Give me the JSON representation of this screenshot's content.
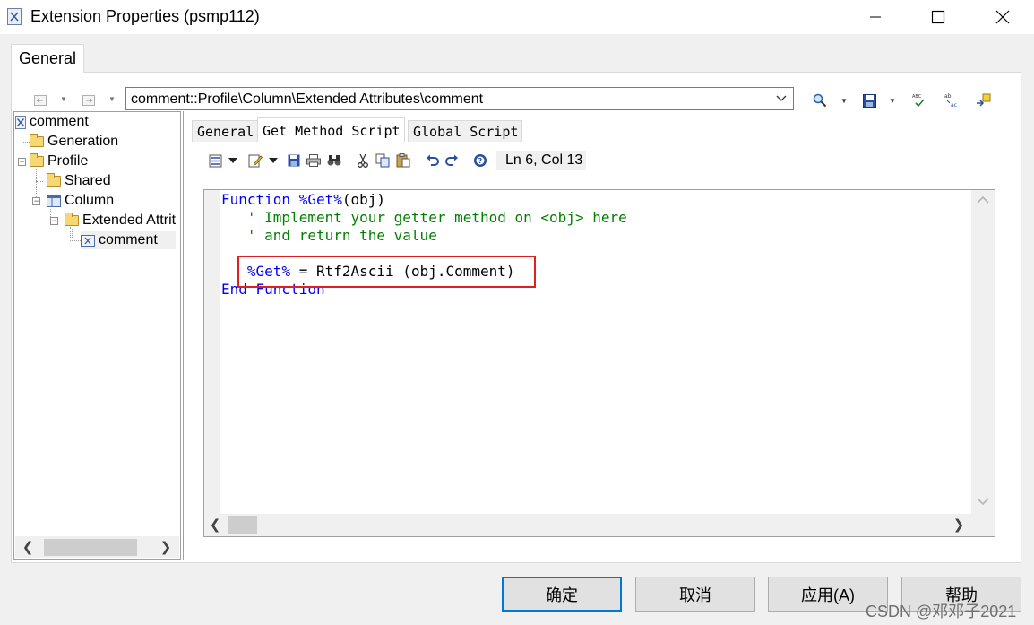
{
  "window": {
    "title": "Extension Properties (psmp112)",
    "icons": [
      "app-icon",
      "minimize-icon",
      "maximize-icon",
      "close-icon"
    ]
  },
  "outer_tab": {
    "label": "General"
  },
  "path_bar": {
    "value": "comment::Profile\\Column\\Extended Attributes\\comment",
    "icons": [
      "back-icon",
      "forward-icon",
      "find-icon",
      "save-icon",
      "spell-check-icon",
      "replace-icon",
      "pin-icon"
    ]
  },
  "tree": {
    "items": [
      {
        "label": "comment",
        "icon": "extension-icon"
      },
      {
        "label": "Generation",
        "icon": "folder-icon"
      },
      {
        "label": "Profile",
        "icon": "folder-icon"
      },
      {
        "label": "Shared",
        "icon": "folder-icon"
      },
      {
        "label": "Column",
        "icon": "column-icon"
      },
      {
        "label": "Extended Attrit",
        "icon": "folder-icon"
      },
      {
        "label": "comment",
        "icon": "attribute-icon"
      }
    ]
  },
  "inner_tabs": [
    {
      "label": "General",
      "active": false
    },
    {
      "label": "Get Method Script",
      "active": true
    },
    {
      "label": "Global Script",
      "active": false
    }
  ],
  "editor_toolbar": {
    "icons": [
      "properties-icon",
      "edit-icon",
      "save-icon",
      "print-icon",
      "find-icon",
      "cut-icon",
      "copy-icon",
      "paste-icon",
      "undo-icon",
      "redo-icon",
      "help-icon"
    ],
    "cursor_status": "Ln 6, Col 13"
  },
  "code": {
    "line1": {
      "kw1": "Function ",
      "kw2": "%Get%",
      "rest": "(obj)"
    },
    "line2": "   ' Implement your getter method on <obj> here",
    "line3": "   ' and return the value",
    "line4": {
      "indent": "   ",
      "kw": "%Get%",
      "rest": " = Rtf2Ascii (obj.Comment)"
    },
    "line5": "End Function"
  },
  "buttons": {
    "ok": "确定",
    "cancel": "取消",
    "apply": "应用(A)",
    "help": "帮助"
  },
  "watermark": "CSDN @邓邓子2021",
  "colors": {
    "keyword": "#0000ff",
    "comment": "#008000",
    "highlight_box": "#e02020",
    "default_button_border": "#0078d7"
  }
}
